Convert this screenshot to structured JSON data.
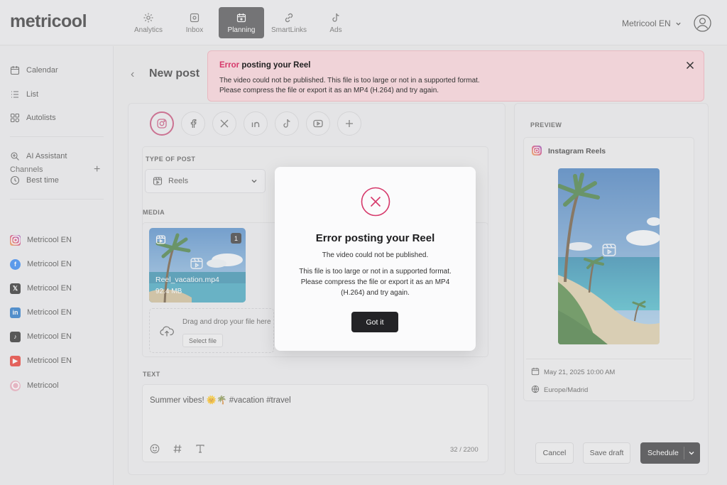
{
  "app": {
    "logo": "metricool"
  },
  "topnav": [
    {
      "label": "Analytics",
      "icon": "gear-icon"
    },
    {
      "label": "Inbox",
      "icon": "inbox-icon"
    },
    {
      "label": "Planning",
      "icon": "calendar-icon",
      "active": true
    },
    {
      "label": "SmartLinks",
      "icon": "link-icon"
    },
    {
      "label": "Ads",
      "icon": "tiktok-icon"
    }
  ],
  "account": {
    "name": "Metricool EN"
  },
  "sidebar": {
    "items": [
      {
        "label": "Calendar",
        "icon": "calendar-icon"
      },
      {
        "label": "List",
        "icon": "list-icon"
      },
      {
        "label": "Autolists",
        "icon": "autolists-icon"
      },
      {
        "label": "AI Assistant",
        "icon": "ai-assistant-icon"
      },
      {
        "label": "Best time",
        "icon": "clock-icon"
      }
    ],
    "channels_label": "Channels",
    "channels": [
      {
        "label": "Metricool EN",
        "network": "instagram"
      },
      {
        "label": "Metricool EN",
        "network": "facebook"
      },
      {
        "label": "Metricool EN",
        "network": "x"
      },
      {
        "label": "Metricool EN",
        "network": "linkedin"
      },
      {
        "label": "Metricool EN",
        "network": "tiktok"
      },
      {
        "label": "Metricool EN",
        "network": "youtube"
      },
      {
        "label": "Metricool",
        "network": "metricool"
      }
    ]
  },
  "page": {
    "title": "New post"
  },
  "post_type": {
    "label": "TYPE OF POST",
    "value": "Reels"
  },
  "media": {
    "label": "MEDIA",
    "file_name": "Reel_vacation.mp4",
    "file_size": "92.4 MB",
    "count": "1",
    "drop_text": "Drag and drop your file here",
    "select_label": "Select file"
  },
  "text": {
    "label": "TEXT",
    "value": "Summer vibes! 🌞🌴 #vacation #travel",
    "count": "32 / 2200"
  },
  "preview": {
    "label": "PREVIEW",
    "title": "Instagram Reels",
    "date": "May 21, 2025 10:00 AM",
    "timezone": "Europe/Madrid"
  },
  "actions": {
    "cancel": "Cancel",
    "save_draft": "Save draft",
    "schedule": "Schedule"
  },
  "toast": {
    "title_prefix": "Error",
    "title_rest": " posting your Reel",
    "line1": "The video could not be published. This file is too large or not in a supported format.",
    "line2": "Please compress the file or export it as an MP4 (H.264) and try again."
  },
  "modal": {
    "title": "Error posting your Reel",
    "line1": "The video could not be published.",
    "line2": "This file is too large or not in a supported format. Please compress the file or export it as an MP4 (H.264) and try again.",
    "button": "Got it"
  },
  "colors": {
    "error": "#d6396b",
    "toast_bg": "#f0d3d8",
    "dark_button": "#232326",
    "instagram": "#c23a6a"
  }
}
